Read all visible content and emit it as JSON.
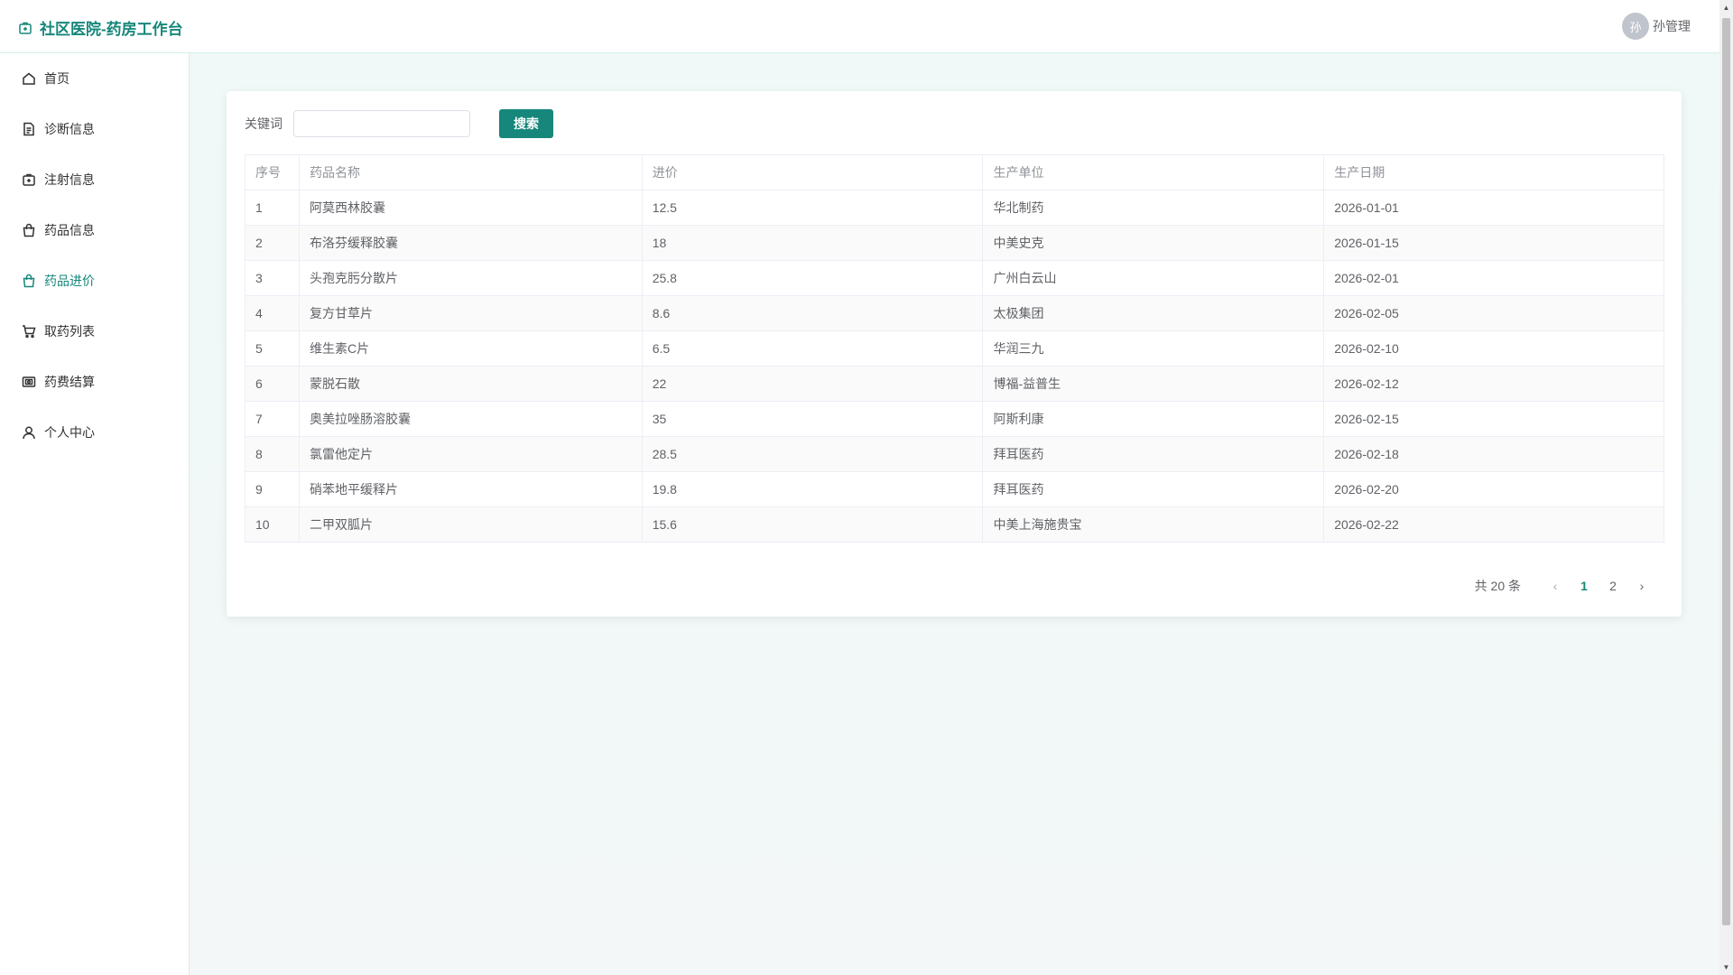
{
  "app": {
    "title": "社区医院-药房工作台"
  },
  "user": {
    "avatar_text": "孙",
    "name": "孙管理"
  },
  "sidebar": {
    "items": [
      {
        "label": "首页",
        "icon": "home-icon"
      },
      {
        "label": "诊断信息",
        "icon": "document-icon"
      },
      {
        "label": "注射信息",
        "icon": "first-aid-kit-icon"
      },
      {
        "label": "药品信息",
        "icon": "shopping-bag-icon"
      },
      {
        "label": "药品进价",
        "icon": "shopping-bag-icon",
        "active": true
      },
      {
        "label": "取药列表",
        "icon": "shopping-cart-icon"
      },
      {
        "label": "药费结算",
        "icon": "wallet-icon"
      },
      {
        "label": "个人中心",
        "icon": "user-icon"
      }
    ]
  },
  "search": {
    "label": "关键词",
    "value": "",
    "placeholder": "",
    "button_label": "搜索"
  },
  "table": {
    "headers": [
      "序号",
      "药品名称",
      "进价",
      "生产单位",
      "生产日期"
    ],
    "rows": [
      [
        "1",
        "阿莫西林胶囊",
        "12.5",
        "华北制药",
        "2026-01-01"
      ],
      [
        "2",
        "布洛芬缓释胶囊",
        "18",
        "中美史克",
        "2026-01-15"
      ],
      [
        "3",
        "头孢克肟分散片",
        "25.8",
        "广州白云山",
        "2026-02-01"
      ],
      [
        "4",
        "复方甘草片",
        "8.6",
        "太极集团",
        "2026-02-05"
      ],
      [
        "5",
        "维生素C片",
        "6.5",
        "华润三九",
        "2026-02-10"
      ],
      [
        "6",
        "蒙脱石散",
        "22",
        "博福-益普生",
        "2026-02-12"
      ],
      [
        "7",
        "奥美拉唑肠溶胶囊",
        "35",
        "阿斯利康",
        "2026-02-15"
      ],
      [
        "8",
        "氯雷他定片",
        "28.5",
        "拜耳医药",
        "2026-02-18"
      ],
      [
        "9",
        "硝苯地平缓释片",
        "19.8",
        "拜耳医药",
        "2026-02-20"
      ],
      [
        "10",
        "二甲双胍片",
        "15.6",
        "中美上海施贵宝",
        "2026-02-22"
      ]
    ]
  },
  "pagination": {
    "total_label": "共 20 条",
    "pages": [
      "1",
      "2"
    ],
    "current": "1",
    "prev": "‹",
    "next": "›"
  },
  "colors": {
    "accent": "#16877a",
    "header_border": "#d6efec"
  }
}
